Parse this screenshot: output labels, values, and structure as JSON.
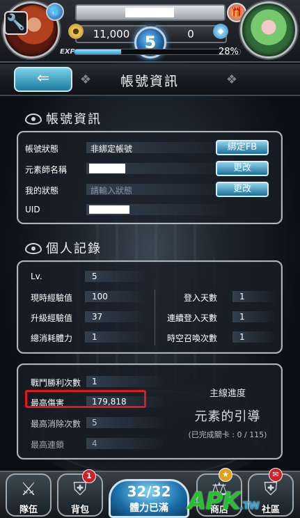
{
  "hud": {
    "gold": "11,000",
    "gems": "0",
    "level": "5",
    "exp_label": "EXP",
    "exp_percent": "28%",
    "exp_fraction": 0.28
  },
  "title": {
    "text": "帳號資訊"
  },
  "account_section": {
    "heading": "帳號資訊",
    "rows": [
      {
        "label": "帳號狀態",
        "value": "非綁定帳號",
        "button": "綁定FB"
      },
      {
        "label": "元素師名稱",
        "value": "",
        "button": "更改"
      },
      {
        "label": "我的狀態",
        "placeholder": "請輸入狀態",
        "button": "更改"
      },
      {
        "label": "UID",
        "value": ""
      }
    ]
  },
  "record_section": {
    "heading": "個人記錄",
    "left_stats": [
      {
        "label": "Lv.",
        "value": "5"
      },
      {
        "label": "現時經驗值",
        "value": "100"
      },
      {
        "label": "升級經驗值",
        "value": "37"
      },
      {
        "label": "總消耗體力",
        "value": "1"
      }
    ],
    "right_stats": [
      {
        "label": "登入天數",
        "value": "1"
      },
      {
        "label": "連續登入天數",
        "value": "1"
      },
      {
        "label": "時空召喚次數",
        "value": "1"
      }
    ],
    "battle_stats": [
      {
        "label": "戰鬥勝利次數",
        "value": "1"
      },
      {
        "label": "最高傷害",
        "value": "179,818"
      },
      {
        "label": "最高消除次數",
        "value": "5"
      },
      {
        "label": "最高連鎖",
        "value": "4"
      }
    ],
    "progress": {
      "title": "主線進度",
      "chapter": "元素的引導",
      "completed": "(已完成關卡 : 0 / 115)"
    }
  },
  "bottom_nav": {
    "team": "隊伍",
    "bag": "背包",
    "bag_badge": "1",
    "stamina": "32/32",
    "stamina_label": "體力已滿",
    "shop": "商店",
    "community": "社區"
  },
  "watermark": {
    "text": "APK",
    "suffix": ".TW"
  },
  "colors": {
    "accent_blue": "#1d6f98",
    "highlight_red": "#e0171f",
    "panel_border": "#aeb6bd"
  }
}
